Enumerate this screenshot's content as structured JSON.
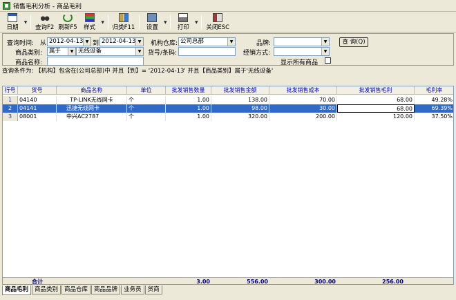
{
  "window": {
    "title": "销售毛利分析 - 商品毛利"
  },
  "toolbar": {
    "date": "日期",
    "query": "查询F2",
    "refresh": "刷新F5",
    "style": "样式",
    "group": "归类F11",
    "settings": "设置",
    "print": "打印",
    "close": "关闭ESC"
  },
  "filters": {
    "query_time_label": "查询时间:",
    "from_label": "从",
    "date_from": "2012-04-13",
    "to_label": "到",
    "date_to": "2012-04-13",
    "warehouse_label": "机构仓库:",
    "warehouse_value": "公司总部",
    "brand_label": "品牌:",
    "brand_value": "",
    "query_button": "查 询(Q)",
    "category_label": "商品类别:",
    "category_op": "属于",
    "category_value": "无线设备",
    "code_label": "货号/条码:",
    "code_value": "",
    "sale_mode_label": "经销方式:",
    "sale_mode_value": "",
    "name_label": "商品名称:",
    "name_value": "",
    "show_all_label": "显示所有商品"
  },
  "condition_text": "查询条件为: 【机构】包含在(公司总部)中 并且【到】= '2012-04-13' 并且【商品类别】属于'无线设备'",
  "table": {
    "headers": [
      "行号",
      "货号",
      "商品名称",
      "单位",
      "批发销售数量",
      "批发销售金额",
      "批发销售成本",
      "批发销售毛利",
      "毛利率"
    ],
    "rows": [
      [
        "1",
        "04140",
        "TP-LINK无线网卡",
        "个",
        "1.00",
        "138.00",
        "70.00",
        "68.00",
        "49.28%"
      ],
      [
        "2",
        "04141",
        "迅捷无线网卡",
        "个",
        "1.00",
        "98.00",
        "30.00",
        "68.00",
        "69.39%"
      ],
      [
        "3",
        "08001",
        "中兴AC2787",
        "个",
        "1.00",
        "320.00",
        "200.00",
        "120.00",
        "37.50%"
      ]
    ],
    "selected_row": 2,
    "total_label": "合计",
    "totals": {
      "qty": "3.00",
      "amount": "556.00",
      "cost": "300.00",
      "profit": "256.00"
    }
  },
  "tabs": [
    "商品毛利",
    "商品类别",
    "商品仓库",
    "商品品牌",
    "业务员",
    "货商"
  ],
  "active_tab": 0
}
